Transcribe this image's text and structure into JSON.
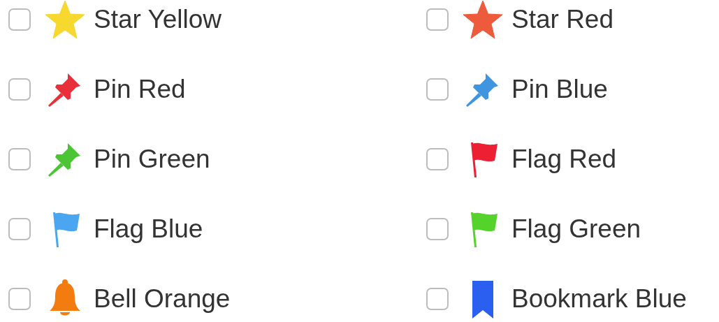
{
  "items": [
    {
      "label": "Star Yellow",
      "kind": "star",
      "color": "#f7d82e",
      "checked": false
    },
    {
      "label": "Star Red",
      "kind": "star",
      "color": "#ee5a3c",
      "checked": false
    },
    {
      "label": "Pin Red",
      "kind": "pin",
      "color": "#e8303a",
      "checked": false
    },
    {
      "label": "Pin Blue",
      "kind": "pin",
      "color": "#3f95e0",
      "checked": false
    },
    {
      "label": "Pin Green",
      "kind": "pin",
      "color": "#4cc534",
      "checked": false
    },
    {
      "label": "Flag Red",
      "kind": "flag",
      "color": "#ec1f33",
      "checked": false
    },
    {
      "label": "Flag Blue",
      "kind": "flag",
      "color": "#4aa6f0",
      "checked": false
    },
    {
      "label": "Flag Green",
      "kind": "flag",
      "color": "#56d22c",
      "checked": false
    },
    {
      "label": "Bell Orange",
      "kind": "bell",
      "color": "#f27c10",
      "checked": false
    },
    {
      "label": "Bookmark Blue",
      "kind": "bookmark",
      "color": "#2a5ff0",
      "checked": false
    }
  ]
}
